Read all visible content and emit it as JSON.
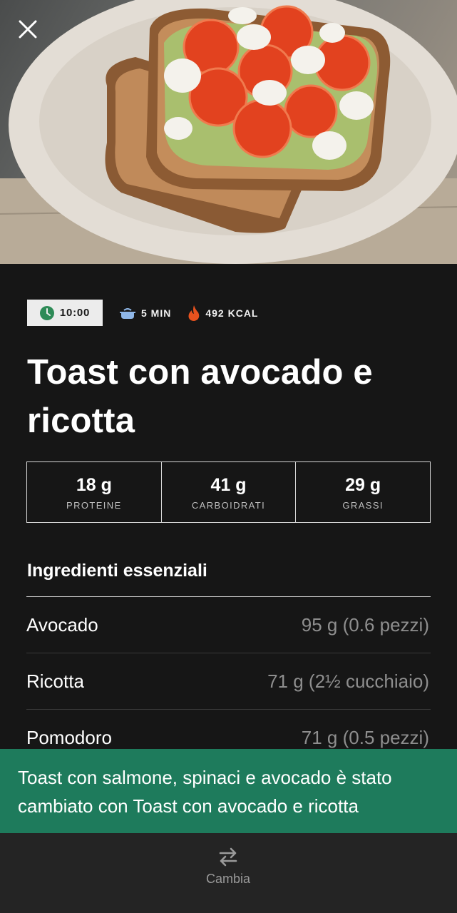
{
  "meta": {
    "time": "10:00",
    "duration": "5 MIN",
    "calories": "492 KCAL"
  },
  "recipe": {
    "title": "Toast con avocado e ricotta"
  },
  "macros": [
    {
      "value": "18 g",
      "label": "PROTEINE"
    },
    {
      "value": "41 g",
      "label": "CARBOIDRATI"
    },
    {
      "value": "29 g",
      "label": "GRASSI"
    }
  ],
  "ingredients": {
    "title": "Ingredienti essenziali",
    "items": [
      {
        "name": "Avocado",
        "qty": "95 g (0.6 pezzi)"
      },
      {
        "name": "Ricotta",
        "qty": "71 g (2½ cucchiaio)"
      },
      {
        "name": "Pomodoro",
        "qty": "71 g (0.5 pezzi)"
      }
    ]
  },
  "toast": {
    "message": "Toast con salmone, spinaci e avocado è stato cambiato con Toast con avocado e ricotta"
  },
  "bottom": {
    "change_label": "Cambia"
  },
  "colors": {
    "background": "#161616",
    "toast": "#1e7b5c",
    "clock_icon": "#2e8b57",
    "pot_icon": "#8fb7e8",
    "flame_icon": "#e8521e"
  },
  "icons": {
    "close": "close-icon",
    "clock": "clock-icon",
    "pot": "pot-icon",
    "flame": "flame-icon",
    "swap": "swap-arrows-icon"
  }
}
